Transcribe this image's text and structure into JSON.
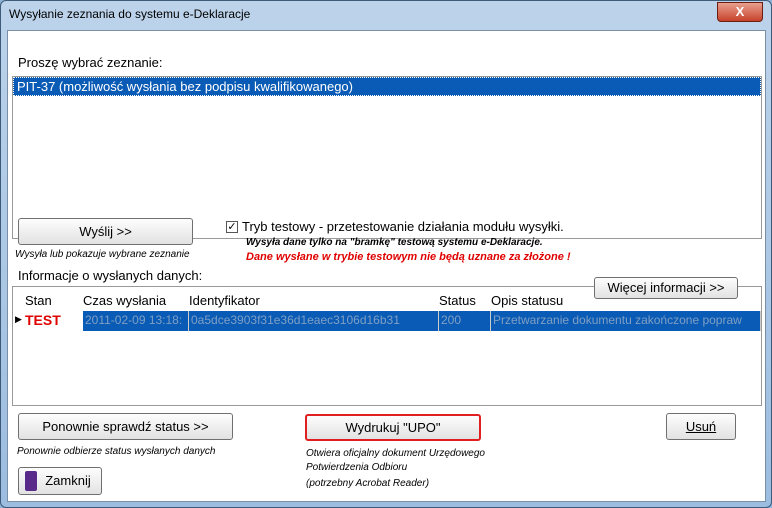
{
  "window": {
    "title": "Wysyłanie zeznania do systemu e-Deklaracje",
    "close": "X"
  },
  "select": {
    "label": "Proszę wybrać zeznanie:",
    "items": [
      "PIT-37 (możliwość wysłania bez podpisu kwalifikowanego)"
    ]
  },
  "send": {
    "label": "Wyślij >>",
    "hint": "Wysyła lub pokazuje wybrane zeznanie"
  },
  "test_mode": {
    "checked": true,
    "label": "Tryb testowy - przetestowanie działania modułu wysyłki.",
    "hint": "Wysyła dane tylko na \"bramkę\" testową systemu e-Deklaracje.",
    "warning": "Dane wysłane w trybie testowym nie będą uznane za złożone !",
    "warning_color": "#e00000"
  },
  "info": {
    "label": "Informacje o wysłanych danych:",
    "more_button": "Więcej informacji >>"
  },
  "table": {
    "columns": [
      "Stan",
      "Czas wysłania",
      "Identyfikator",
      "Status",
      "Opis statusu"
    ],
    "rows": [
      [
        "TEST",
        "2011-02-09 13:18:",
        "0a5dce3903f31e36d1eaec3106d16b31",
        "200",
        "Przetwarzanie dokumentu zakończone popraw"
      ]
    ]
  },
  "recheck": {
    "label": "Ponownie sprawdź status >>",
    "hint": "Ponownie odbierze status wysłanych danych"
  },
  "print_upo": {
    "label": "Wydrukuj \"UPO\"",
    "hint1": "Otwiera oficjalny dokument Urzędowego",
    "hint2": "Potwierdzenia Odbioru",
    "hint3": "(potrzebny Acrobat Reader)"
  },
  "delete": {
    "label": "Usuń"
  },
  "close_button": {
    "label": "Zamknij",
    "icon": "exit-door-icon"
  }
}
